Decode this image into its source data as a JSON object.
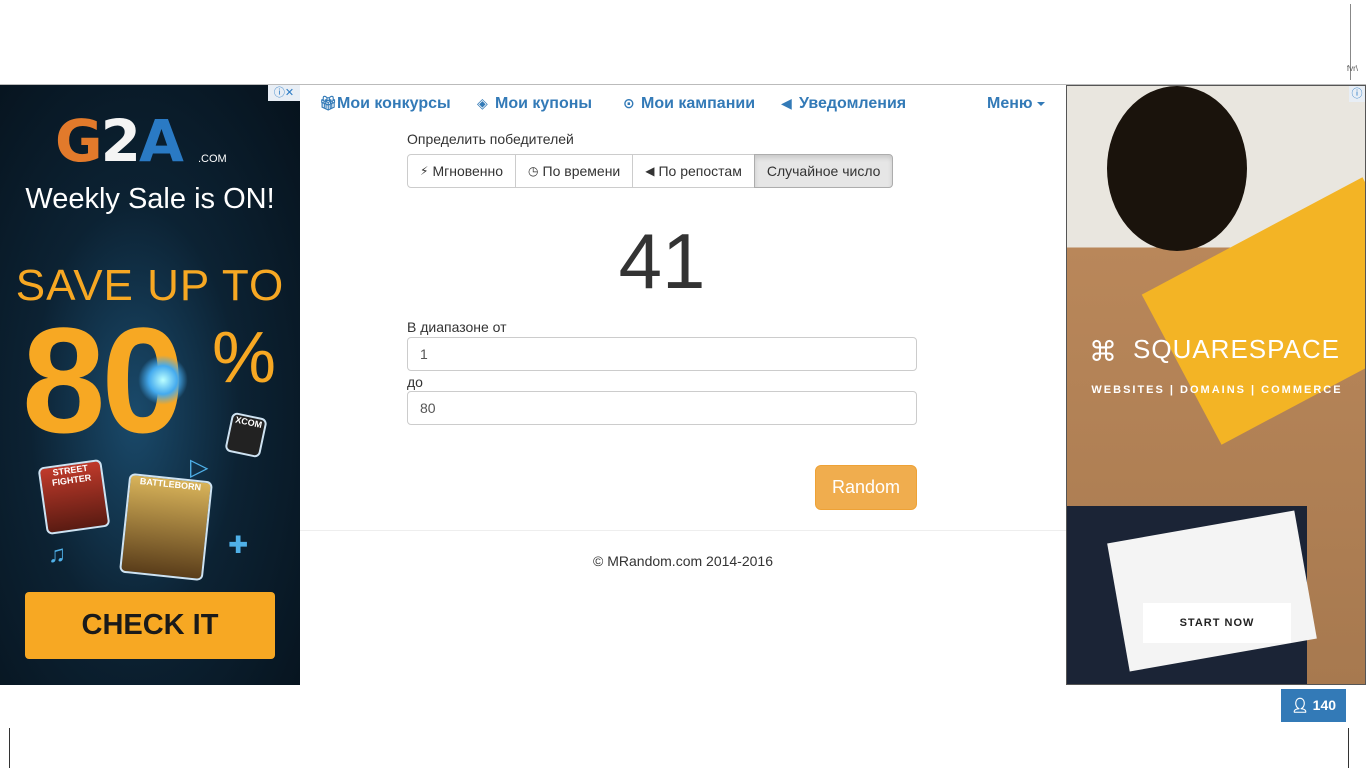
{
  "top_ad": {
    "tiny_text": "fvr\\"
  },
  "left_ad": {
    "adchoice": "ⓘ✕",
    "logo_g": "G",
    "logo_2": "2",
    "logo_a": "A",
    "logo_com": ".COM",
    "headline": "Weekly Sale is ON!",
    "save_up": "SAVE UP TO",
    "big_number": "80",
    "percent": "%",
    "game1": "STREET FIGHTER",
    "game2": "BATTLEBORN",
    "game3": "XCOM",
    "cta": "CHECK IT"
  },
  "right_ad": {
    "adchoice": "ⓘ",
    "brand": "SQUARESPACE",
    "tagline": "WEBSITES | DOMAINS | COMMERCE",
    "cta": "START NOW"
  },
  "nav": {
    "contests": "Мои конкурсы",
    "coupons": "Мои купоны",
    "campaigns": "Мои кампании",
    "notifications": "Уведомления",
    "menu": "Меню"
  },
  "winner": {
    "label": "Определить победителей",
    "tabs": [
      {
        "label": "Мгновенно",
        "icon": "bolt-icon"
      },
      {
        "label": "По времени",
        "icon": "clock-icon"
      },
      {
        "label": "По репостам",
        "icon": "megaphone-icon"
      },
      {
        "label": "Случайное число",
        "active": true
      }
    ]
  },
  "result": "41",
  "range": {
    "from_label": "В диапазоне от",
    "from_value": "1",
    "to_label": "до",
    "to_value": "80"
  },
  "random_button": "Random",
  "footer": "© MRandom.com 2014-2016",
  "online_counter": "140",
  "colors": {
    "link": "#337ab7",
    "warning": "#f0ad4e",
    "g2a_orange": "#f7a823"
  }
}
